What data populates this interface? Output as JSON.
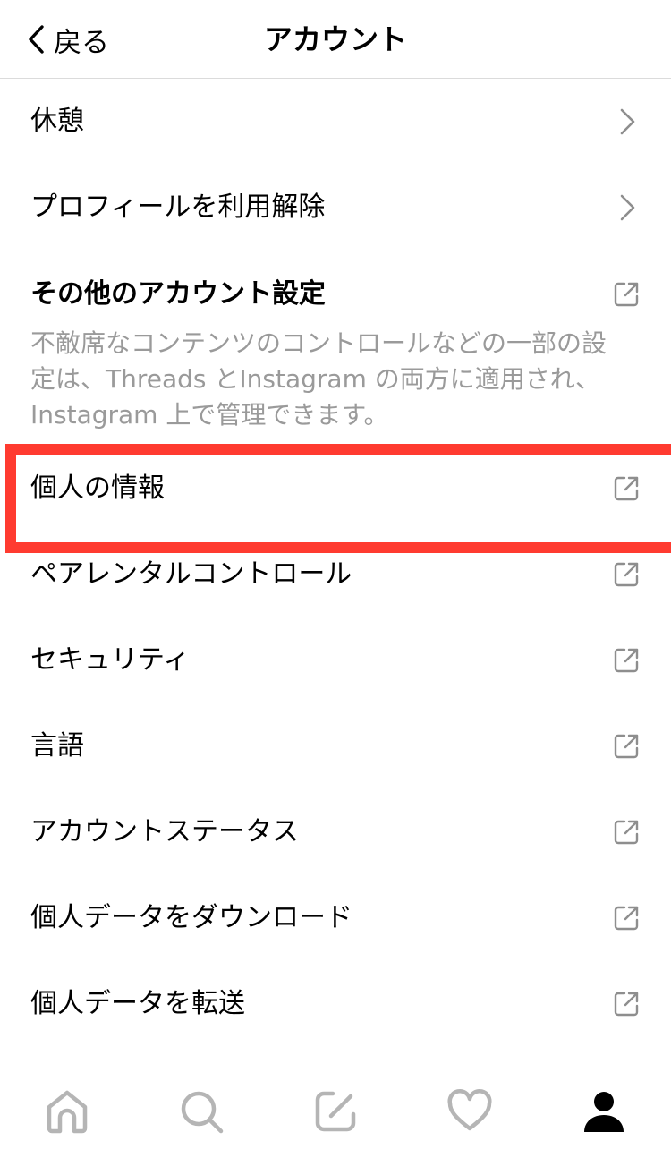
{
  "header": {
    "back_label": "戻る",
    "title": "アカウント"
  },
  "rows_top": [
    {
      "label": "休憩",
      "icon": "chevron-right-icon"
    },
    {
      "label": "プロフィールを利用解除",
      "icon": "chevron-right-icon"
    }
  ],
  "section": {
    "title": "その他のアカウント設定",
    "icon": "external-link-icon",
    "description": "不敵席なコンテンツのコントロールなどの一部の設定は、Threads とInstagram の両方に適用され、Instagram 上で管理できます。"
  },
  "rows_external": [
    {
      "label": "個人の情報",
      "icon": "external-link-icon"
    },
    {
      "label": "ペアレンタルコントロール",
      "icon": "external-link-icon"
    },
    {
      "label": "セキュリティ",
      "icon": "external-link-icon"
    },
    {
      "label": "言語",
      "icon": "external-link-icon"
    },
    {
      "label": "アカウントステータス",
      "icon": "external-link-icon"
    },
    {
      "label": "個人データをダウンロード",
      "icon": "external-link-icon"
    },
    {
      "label": "個人データを転送",
      "icon": "external-link-icon"
    }
  ],
  "highlight_color": "#ff3b30",
  "secondary_text_color": "#9a9a9a",
  "tabbar": [
    "home-icon",
    "search-icon",
    "compose-icon",
    "heart-icon",
    "profile-icon"
  ]
}
